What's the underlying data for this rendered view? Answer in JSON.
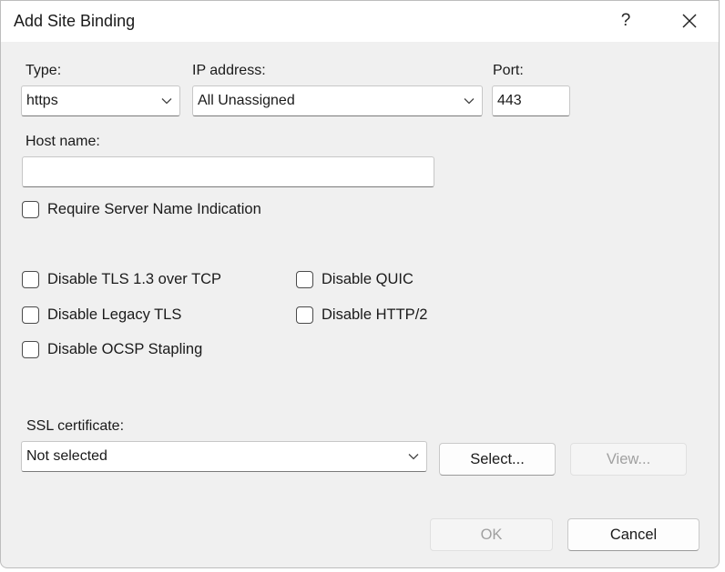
{
  "dialog": {
    "title": "Add Site Binding",
    "help_label": "?",
    "close_label": "✕"
  },
  "type": {
    "label": "Type:",
    "value": "https"
  },
  "ip": {
    "label": "IP address:",
    "value": "All Unassigned"
  },
  "port": {
    "label": "Port:",
    "value": "443"
  },
  "host": {
    "label": "Host name:",
    "value": ""
  },
  "sni": {
    "label": "Require Server Name Indication",
    "checked": false
  },
  "options": {
    "disable_tls13": "Disable TLS 1.3 over TCP",
    "disable_quic": "Disable QUIC",
    "disable_legacy_tls": "Disable Legacy TLS",
    "disable_http2": "Disable HTTP/2",
    "disable_ocsp": "Disable OCSP Stapling"
  },
  "ssl": {
    "label": "SSL certificate:",
    "value": "Not selected",
    "select_label": "Select...",
    "view_label": "View..."
  },
  "footer": {
    "ok_label": "OK",
    "cancel_label": "Cancel"
  },
  "icons": {
    "chevron": "chevron-down-icon",
    "close": "close-icon",
    "help": "help-icon"
  }
}
